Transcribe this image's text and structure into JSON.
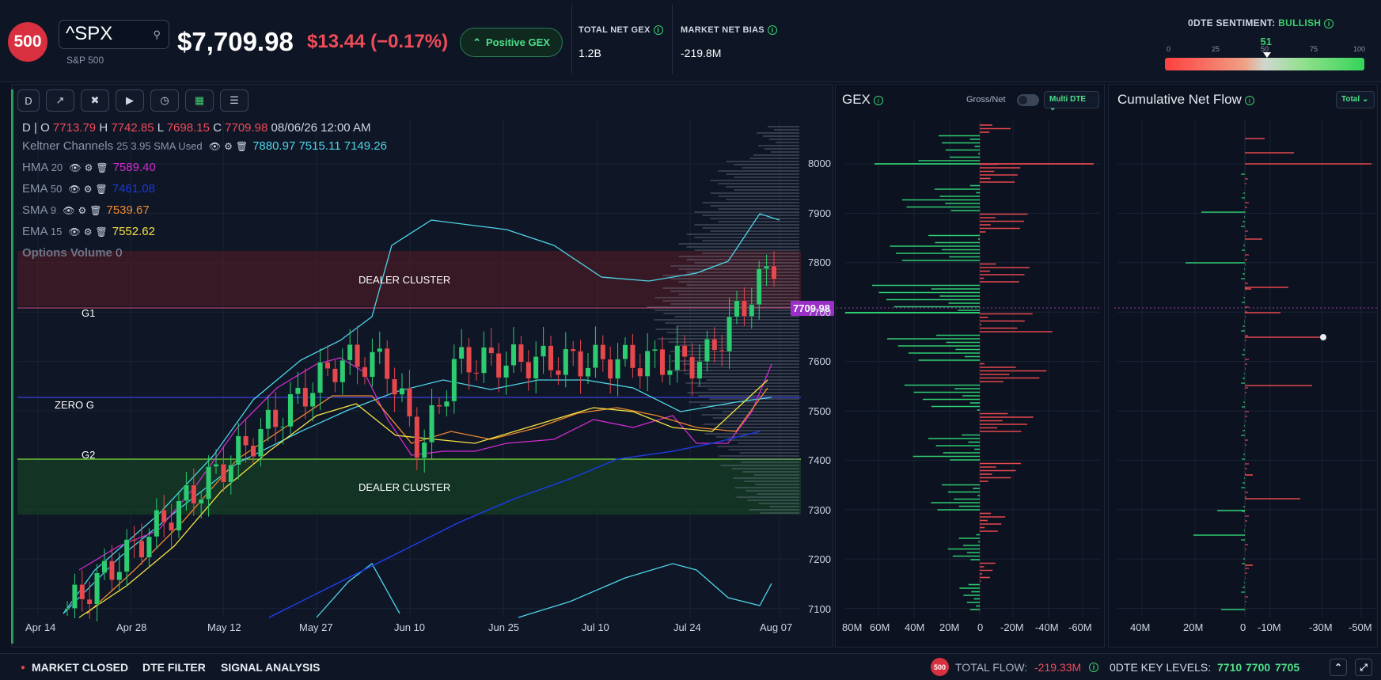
{
  "header": {
    "logo": "500",
    "ticker": "^SPX",
    "name": "S&P 500",
    "price": "$7,709.98",
    "change": "$13.44 (−0.17%)",
    "gex_badge": "Positive GEX",
    "metrics": [
      {
        "label": "TOTAL NET GEX",
        "value": "1.2B"
      },
      {
        "label": "MARKET NET BIAS",
        "value": "-219.8M"
      }
    ],
    "sentiment": {
      "label": "0DTE SENTIMENT:",
      "value": "BULLISH",
      "score": "51",
      "score_fraction": 0.51,
      "ticks": [
        "0",
        "25",
        "50",
        "75",
        "100"
      ]
    }
  },
  "toolbar": {
    "interval": "D",
    "icons": [
      "indicator-icon",
      "drawing-icon",
      "replay-icon",
      "history-icon",
      "calendar-icon",
      "settings-icon"
    ]
  },
  "legend": {
    "ohlc": {
      "prefix": "D |",
      "o_label": "O",
      "o": "7713.79",
      "h_label": "H",
      "h": "7742.85",
      "l_label": "L",
      "l": "7698.15",
      "c_label": "C",
      "c": "7709.98",
      "date": "08/06/26 12:00 AM"
    },
    "indicators": [
      {
        "name": "Keltner Channels",
        "params": "25 3.95 SMA Used",
        "values": "7880.97 7515.11 7149.26",
        "color": "#4fd5e8"
      },
      {
        "name": "HMA",
        "params": "20",
        "values": "7589.40",
        "color": "#d12ccf"
      },
      {
        "name": "EMA",
        "params": "50",
        "values": "7461.08",
        "color": "#1c3ad6"
      },
      {
        "name": "SMA",
        "params": "9",
        "values": "7539.67",
        "color": "#f08a2e"
      },
      {
        "name": "EMA",
        "params": "15",
        "values": "7552.62",
        "color": "#f5e342"
      }
    ],
    "options_volume": {
      "name": "Options Volume",
      "value": "0"
    }
  },
  "chart_labels": {
    "dealer_cluster_top": "DEALER CLUSTER",
    "dealer_cluster_bottom": "DEALER CLUSTER",
    "g1": "G1",
    "zero_g": "ZERO G",
    "g2": "G2",
    "last_price": "7709.98"
  },
  "x_labels": [
    "Apr 14",
    "Apr 28",
    "May 12",
    "May 27",
    "Jun 10",
    "Jun 25",
    "Jul 10",
    "Jul 24",
    "Aug 07"
  ],
  "y_labels": [
    "8000",
    "7900",
    "7800",
    "7700",
    "7600",
    "7500",
    "7400",
    "7300",
    "7200",
    "7100"
  ],
  "gex_panel": {
    "title": "GEX",
    "toggle_label": "Gross/Net",
    "select": "Multi DTE",
    "x_labels": [
      "80M",
      "60M",
      "40M",
      "20M",
      "0",
      "-20M",
      "-40M",
      "-60M"
    ]
  },
  "flow_panel": {
    "title": "Cumulative Net Flow",
    "select": "Total",
    "x_labels": [
      "40M",
      "20M",
      "0",
      "-10M",
      "-30M",
      "-50M"
    ]
  },
  "footer": {
    "market": "MARKET CLOSED",
    "dte": "DTE FILTER",
    "signal": "SIGNAL ANALYSIS",
    "logo": "500",
    "total_flow_label": "TOTAL FLOW:",
    "total_flow": "-219.33M",
    "key_levels_label": "0DTE KEY LEVELS:",
    "levels": [
      "7710",
      "7700",
      "7705"
    ]
  },
  "colors": {
    "bull": "#2ecc71",
    "bear": "#e5484d",
    "accent": "#3bd16f"
  }
}
